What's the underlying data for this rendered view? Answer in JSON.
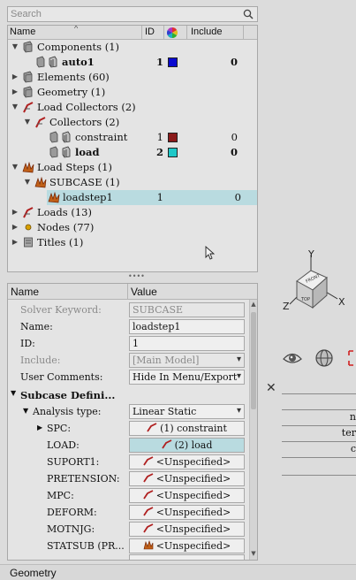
{
  "search": {
    "placeholder": "Search"
  },
  "tree": {
    "columns": {
      "name": "Name",
      "id": "ID",
      "include": "Include"
    },
    "rows": {
      "components": "Components (1)",
      "auto1": {
        "label": "auto1",
        "id": "1",
        "include": "0",
        "color": "#0a0ad0"
      },
      "elements": "Elements (60)",
      "geometry": "Geometry (1)",
      "load_collectors": "Load Collectors (2)",
      "collectors": "Collectors (2)",
      "constraint": {
        "label": "constraint",
        "id": "1",
        "include": "0",
        "color": "#8b1a1a"
      },
      "load": {
        "label": "load",
        "id": "2",
        "include": "0",
        "color": "#1ec8c8"
      },
      "load_steps": "Load Steps (1)",
      "subcase": "SUBCASE (1)",
      "loadstep1": {
        "label": "loadstep1",
        "id": "1",
        "include": "0"
      },
      "loads": "Loads (13)",
      "nodes": "Nodes (77)",
      "titles": "Titles (1)"
    }
  },
  "props": {
    "columns": {
      "name": "Name",
      "value": "Value"
    },
    "solver_keyword": {
      "label": "Solver Keyword:",
      "value": "SUBCASE"
    },
    "name": {
      "label": "Name:",
      "value": "loadstep1"
    },
    "id": {
      "label": "ID:",
      "value": "1"
    },
    "include": {
      "label": "Include:",
      "value": "[Main Model]"
    },
    "user_comments": {
      "label": "User Comments:",
      "value": "Hide In Menu/Export"
    },
    "subcase_def": {
      "label": "Subcase Defini..."
    },
    "analysis_type": {
      "label": "Analysis type:",
      "value": "Linear Static"
    },
    "spc": {
      "label": "SPC:",
      "value": "(1) constraint"
    },
    "load": {
      "label": "LOAD:",
      "value": "(2) load"
    },
    "suport1": {
      "label": "SUPORT1:",
      "value": "<Unspecified>"
    },
    "pretension": {
      "label": "PRETENSION:",
      "value": "<Unspecified>"
    },
    "mpc": {
      "label": "MPC:",
      "value": "<Unspecified>"
    },
    "deform": {
      "label": "DEFORM:",
      "value": "<Unspecified>"
    },
    "motnjg": {
      "label": "MOTNJG:",
      "value": "<Unspecified>"
    },
    "statsub": {
      "label": "STATSUB (PR...",
      "value": "<Unspecified>"
    }
  },
  "viewcube": {
    "x": "X",
    "y": "Y",
    "z": "Z"
  },
  "mini_table": {
    "r1": "n",
    "r2": "ter",
    "r3": "c"
  },
  "status": {
    "text": "Geometry"
  }
}
